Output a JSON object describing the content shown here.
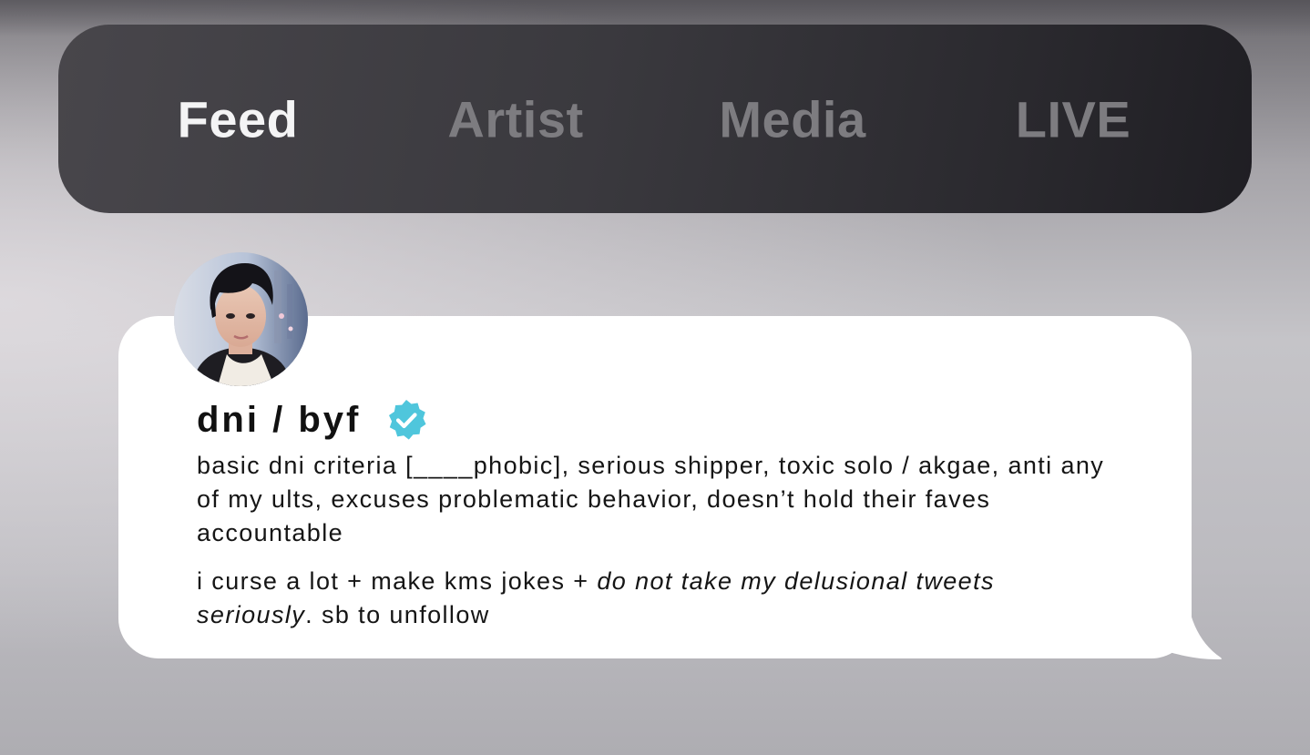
{
  "nav": {
    "tabs": [
      {
        "label": "Feed",
        "active": true
      },
      {
        "label": "Artist",
        "active": false
      },
      {
        "label": "Media",
        "active": false
      },
      {
        "label": "LIVE",
        "active": false
      }
    ]
  },
  "profile": {
    "name": "dni / byf",
    "verified_icon": "verified-badge-icon",
    "bio_paragraph_1": "basic dni criteria [____phobic], serious shipper, toxic solo / akgae, anti any of my ults, excuses problematic behavior, doesn’t hold their faves accountable",
    "bio_paragraph_2_plain": "i curse a lot + make kms jokes + ",
    "bio_paragraph_2_italic": "do not take my delusional tweets seriously",
    "bio_paragraph_2_end": ". sb to unfollow"
  },
  "colors": {
    "nav_background": "#3a393e",
    "tab_active": "#f4f4f5",
    "tab_inactive": "#7d7c80",
    "bubble": "#ffffff",
    "verified_badge": "#4fc6dc",
    "text": "#111111"
  }
}
